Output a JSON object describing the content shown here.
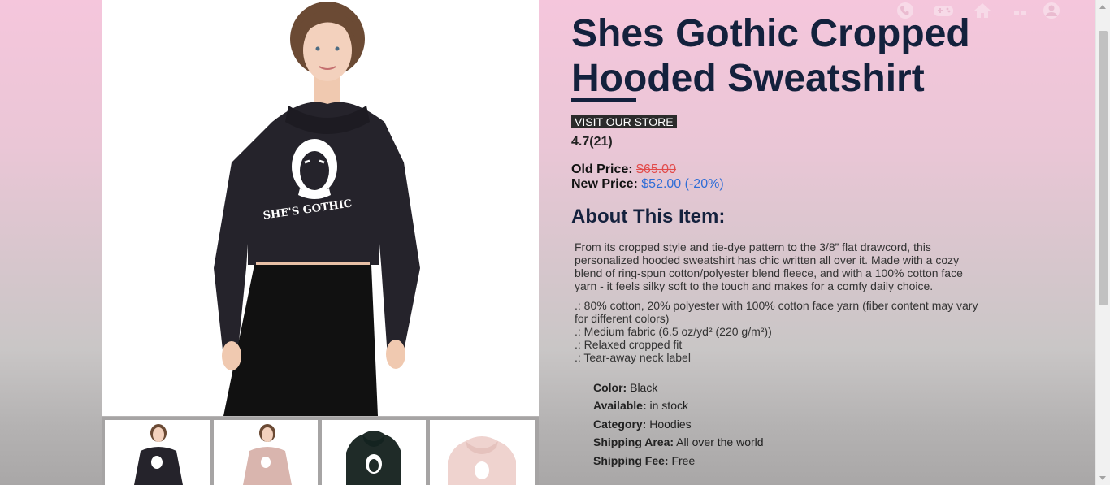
{
  "product": {
    "title": "Shes Gothic Cropped Hooded Sweatshirt",
    "store_button": "VISIT OUR STORE",
    "rating": "4.7(21)",
    "old_price_label": "Old Price:",
    "old_price": "$65.00",
    "new_price_label": "New Price:",
    "new_price": "$52.00 (-20%)",
    "shirt_print": "SHE'S GOTHIC",
    "about_title": "About This Item:",
    "description": [
      "From its cropped style and tie-dye pattern to the 3/8” flat drawcord, this personalized hooded sweatshirt has chic written all over it. Made with a cozy blend of ring-spun cotton/polyester blend fleece, and with a 100% cotton face yarn - it feels silky soft to the touch and makes for a comfy daily choice.",
      ".: 80% cotton, 20% polyester with 100% cotton face yarn (fiber content may vary for different colors)",
      ".: Medium fabric (6.5 oz/yd² (220 g/m²))",
      ".: Relaxed cropped fit",
      ".: Tear-away neck label"
    ],
    "specs": [
      {
        "label": "Color:",
        "value": "Black"
      },
      {
        "label": "Available:",
        "value": "in stock"
      },
      {
        "label": "Category:",
        "value": "Hoodies"
      },
      {
        "label": "Shipping Area:",
        "value": "All over the world"
      },
      {
        "label": "Shipping Fee:",
        "value": "Free"
      }
    ]
  },
  "nav_icons": [
    "phone-icon",
    "gamepad-icon",
    "home-icon",
    "menu-icon",
    "user-icon"
  ],
  "thumbnails": [
    "black-hoodie-model",
    "pink-hoodie-model",
    "black-hoodie-flat",
    "pink-hoodie-flat"
  ],
  "colors": {
    "title": "#14213d",
    "old_price": "#e34b4b",
    "new_price": "#2f6dd6",
    "button_bg": "#2b2b2b"
  }
}
